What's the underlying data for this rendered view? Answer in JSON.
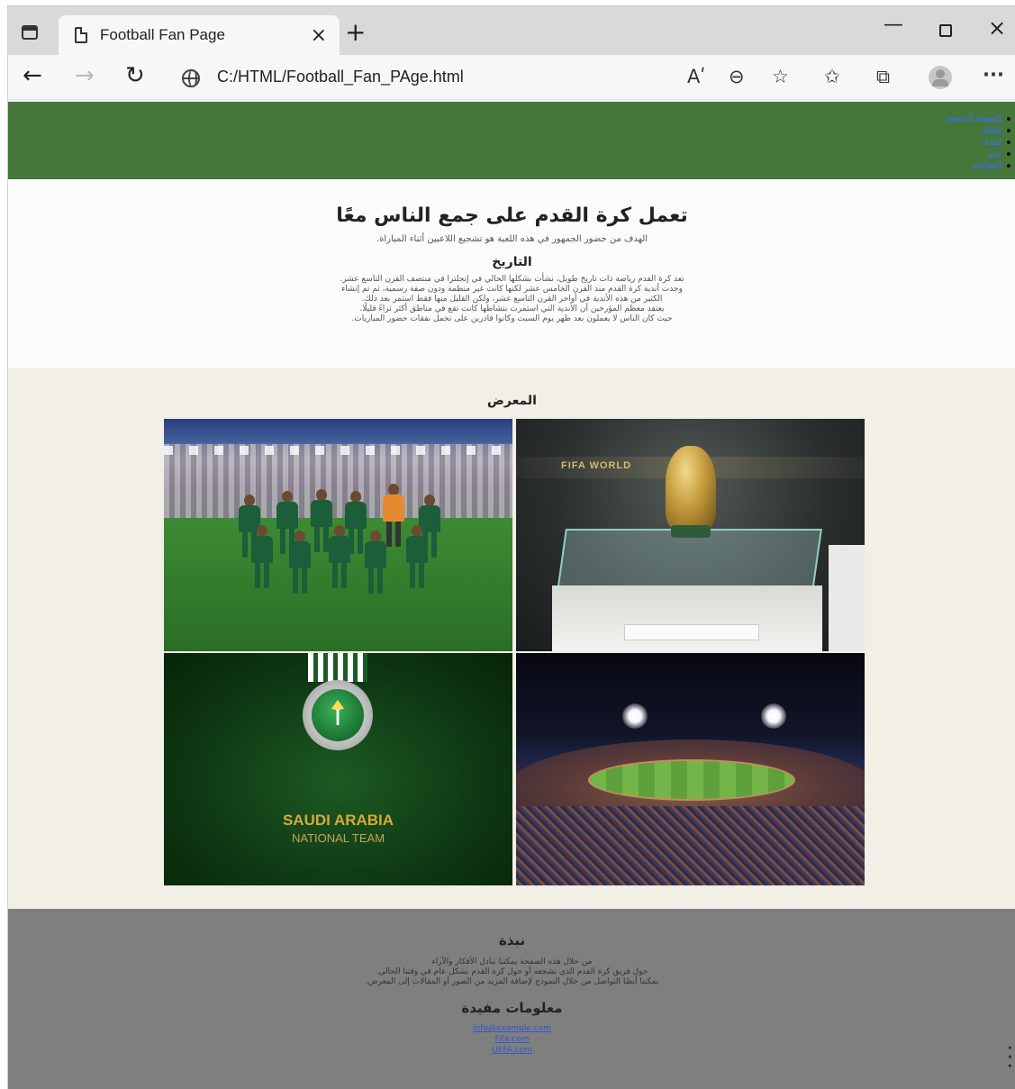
{
  "browser": {
    "tab_title": "Football Fan Page",
    "tab_close": "×",
    "new_tab": "+",
    "win_min": "—",
    "win_close": "×",
    "url": "C:/HTML/Football_Fan_PAge.html",
    "nav_back": "←",
    "nav_forward": "→",
    "nav_reload": "↻",
    "read_aloud": "Aʹ",
    "zoom_icon": "⊖",
    "fav_icon": "☆",
    "favorites_icon": "✩",
    "collections_icon": "⧉",
    "more": "···",
    "icons": [
      "tab-actions-icon",
      "page-icon",
      "globe-icon",
      "read-aloud-icon",
      "zoom-icon",
      "add-favorite-icon",
      "favorites-icon",
      "collections-icon",
      "profile-icon",
      "more-icon"
    ]
  },
  "site": {
    "nav": [
      "الصفحة الرئيسية",
      "الحكم",
      "الفرق",
      "مدن",
      "الفعاليات"
    ],
    "intro": {
      "title": "تعمل كرة القدم على جمع الناس معًا",
      "lead": "الهدف من حضور الجمهور في هذه اللعبة هو تشجيع اللاعبين أثناء المباراة.",
      "history_title": "التاريخ",
      "history_lines": [
        "تعد كرة القدم رياضة ذات تاريخ طويل، نشأت بشكلها الحالي في إنجلترا في منتصف القرن التاسع عشر.",
        "وجدت أندية كرة القدم منذ القرن الخامس عشر لكنها كانت غير منظمة ودون صفة رسمية، ثم تم إنشاء",
        "الكثير من هذه الأندية في أواخر القرن التاسع عشر، ولكن القليل منها فقط استمر بعد ذلك.",
        "يعتقد معظم المؤرخين أن الأندية التي استمرت بنشاطها كانت تقع في مناطق أكثر ثراءً قليلًا.",
        "حيث كان الناس لا يعملون بعد ظهر يوم السبت وكانوا قادرين على تحمل نفقات حضور المباريات."
      ]
    },
    "gallery": {
      "title": "المعرض",
      "images": [
        {
          "name": "team-photo",
          "alt": "team"
        },
        {
          "name": "trophy-photo",
          "alt": "trophy",
          "banner_text": "FIFA WORLD"
        },
        {
          "name": "saudi-logo-photo",
          "alt": "logo",
          "caption_1": "SAUDI ARABIA",
          "caption_2": "NATIONAL TEAM"
        },
        {
          "name": "stadium-photo",
          "alt": "stadium"
        }
      ]
    },
    "about": {
      "title": "نبذة",
      "lines": [
        "من خلال هذه الصفحة يمكننا تبادل الأفكار والآراء",
        "حول فريق كرة القدم الذي نشجعه أو حول كرة القدم بشكل عام في وقتنا الحالي.",
        "يمكننا أيضًا التواصل من خلال النموذج لإضافة المزيد من الصور أو المقالات إلى المعرض."
      ],
      "info_title": "معلومات مفيدة",
      "links": [
        "info@example.com",
        "Fifa.com",
        "UEFA.com"
      ]
    }
  }
}
